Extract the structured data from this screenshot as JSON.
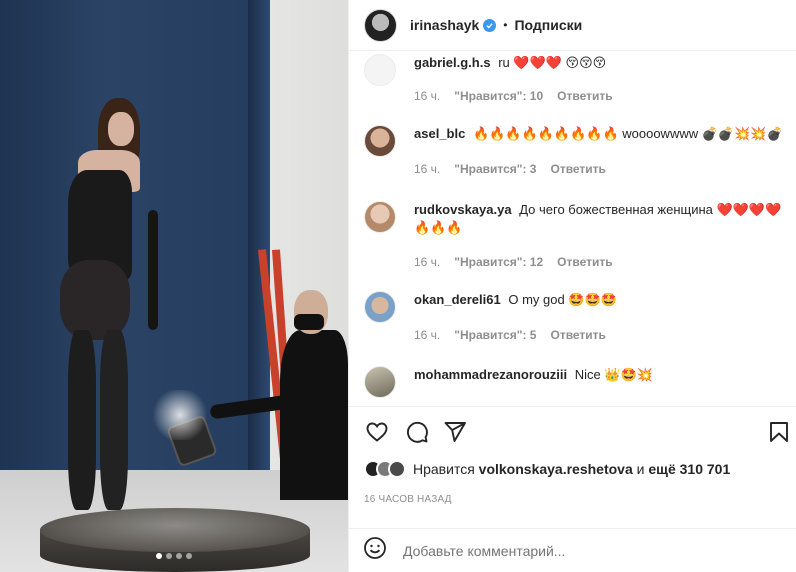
{
  "post": {
    "username": "irinashayk",
    "follow_label": "Подписки",
    "carousel_dots": 4,
    "carousel_active": 0
  },
  "comments": [
    {
      "username": "gabriel.g.h.s",
      "text": "ru ❤️❤️❤️ 😚😚😚",
      "time": "16 ч.",
      "likes": "\"Нравится\": 10",
      "reply": "Ответить"
    },
    {
      "username": "asel_blc",
      "text": "🔥🔥🔥🔥🔥🔥🔥🔥🔥 woooowwww 💣💣💥💥💣",
      "time": "16 ч.",
      "likes": "\"Нравится\": 3",
      "reply": "Ответить"
    },
    {
      "username": "rudkovskaya.ya",
      "text": "До чего божественная женщина ❤️❤️❤️❤️🔥🔥🔥",
      "time": "16 ч.",
      "likes": "\"Нравится\": 12",
      "reply": "Ответить"
    },
    {
      "username": "okan_dereli61",
      "text": "O my god 🤩🤩🤩",
      "time": "16 ч.",
      "likes": "\"Нравится\": 5",
      "reply": "Ответить"
    },
    {
      "username": "mohammadrezanorouziii",
      "text": "Nice 👑🤩💥",
      "time": "",
      "likes": "",
      "reply": ""
    }
  ],
  "likes": {
    "prefix": "Нравится",
    "liked_by": "volkonskaya.reshetova",
    "and": "и",
    "others": "ещё 310 701"
  },
  "time_ago": "16 ЧАСОВ НАЗАД",
  "add_comment": {
    "placeholder": "Добавьте комментарий..."
  },
  "colors": {
    "verified": "#3897f0",
    "text": "#262626",
    "meta": "#8e8e8e"
  },
  "icons": [
    "verified-icon",
    "heart-icon",
    "comment-icon",
    "share-icon",
    "bookmark-icon",
    "emoji-icon"
  ]
}
